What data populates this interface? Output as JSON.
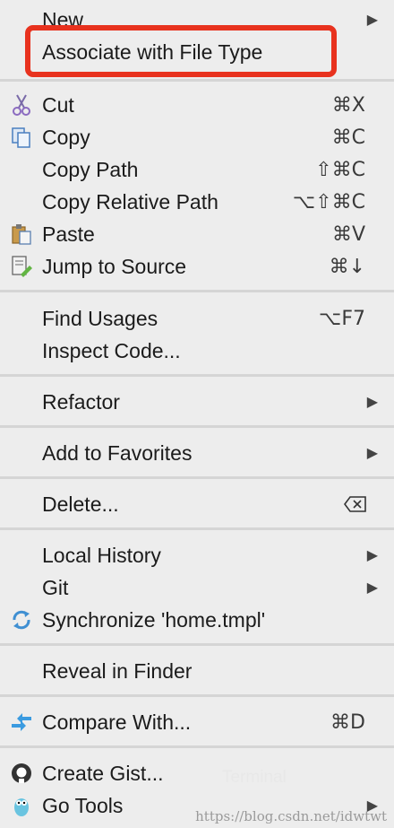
{
  "background_ghost_text": [
    "Terminal"
  ],
  "menu": {
    "items": [
      {
        "label": "New",
        "submenu": true
      },
      {
        "label": "Associate with File Type"
      },
      {
        "label": "Cut",
        "shortcut": "⌘X",
        "icon": "scissors-icon"
      },
      {
        "label": "Copy",
        "shortcut": "⌘C",
        "icon": "copy-icon"
      },
      {
        "label": "Copy Path",
        "shortcut": "⇧⌘C"
      },
      {
        "label": "Copy Relative Path",
        "shortcut": "⌥⇧⌘C"
      },
      {
        "label": "Paste",
        "shortcut": "⌘V",
        "icon": "paste-icon"
      },
      {
        "label": "Jump to Source",
        "shortcut": "⌘↓",
        "icon": "jump-to-source-icon"
      },
      {
        "label": "Find Usages",
        "shortcut": "⌥F7"
      },
      {
        "label": "Inspect Code..."
      },
      {
        "label": "Refactor",
        "submenu": true
      },
      {
        "label": "Add to Favorites",
        "submenu": true
      },
      {
        "label": "Delete...",
        "shortcut_icon": "delete-key-icon"
      },
      {
        "label": "Local History",
        "submenu": true
      },
      {
        "label": "Git",
        "submenu": true
      },
      {
        "label": "Synchronize 'home.tmpl'",
        "icon": "sync-icon"
      },
      {
        "label": "Reveal in Finder"
      },
      {
        "label": "Compare With...",
        "shortcut": "⌘D",
        "icon": "compare-icon"
      },
      {
        "label": "Create Gist...",
        "icon": "github-icon"
      },
      {
        "label": "Go Tools",
        "submenu": true,
        "icon": "gopher-icon"
      }
    ]
  },
  "highlight_color": "#e8321e",
  "watermark": "https://blog.csdn.net/idwtwt"
}
